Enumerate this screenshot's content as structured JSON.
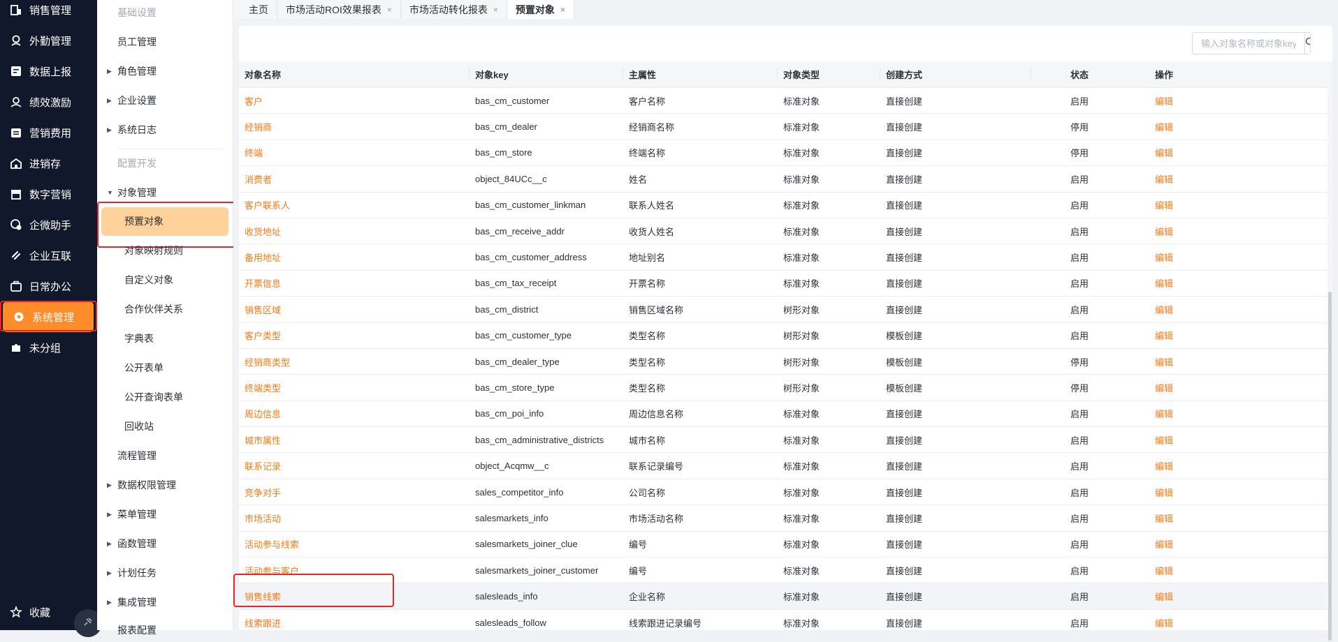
{
  "leftnav": {
    "items": [
      {
        "label": "销售管理",
        "icon": "store-building-icon"
      },
      {
        "label": "外勤管理",
        "icon": "location-person-icon"
      },
      {
        "label": "数据上报",
        "icon": "report-card-icon"
      },
      {
        "label": "绩效激励",
        "icon": "award-person-icon"
      },
      {
        "label": "营销费用",
        "icon": "wallet-icon"
      },
      {
        "label": "进销存",
        "icon": "warehouse-icon"
      },
      {
        "label": "数字营销",
        "icon": "shop-icon"
      },
      {
        "label": "企微助手",
        "icon": "wechat-icon"
      },
      {
        "label": "企业互联",
        "icon": "link-icon"
      },
      {
        "label": "日常办公",
        "icon": "briefcase-icon"
      },
      {
        "label": "系统管理",
        "icon": "gear-icon"
      },
      {
        "label": "未分组",
        "icon": "puzzle-icon"
      }
    ],
    "favorite_label": "收藏"
  },
  "submenu": {
    "items": [
      {
        "label": "基础设置",
        "type": "group"
      },
      {
        "label": "员工管理",
        "type": "item"
      },
      {
        "label": "角色管理",
        "type": "expandable"
      },
      {
        "label": "企业设置",
        "type": "expandable"
      },
      {
        "label": "系统日志",
        "type": "expandable"
      },
      {
        "label": "配置开发",
        "type": "group"
      },
      {
        "label": "对象管理",
        "type": "expanded"
      },
      {
        "label": "预置对象",
        "type": "child-active"
      },
      {
        "label": "对象映射规则",
        "type": "child"
      },
      {
        "label": "自定义对象",
        "type": "child"
      },
      {
        "label": "合作伙伴关系",
        "type": "child"
      },
      {
        "label": "字典表",
        "type": "child"
      },
      {
        "label": "公开表单",
        "type": "child"
      },
      {
        "label": "公开查询表单",
        "type": "child"
      },
      {
        "label": "回收站",
        "type": "child"
      },
      {
        "label": "流程管理",
        "type": "item"
      },
      {
        "label": "数据权限管理",
        "type": "expandable"
      },
      {
        "label": "菜单管理",
        "type": "expandable"
      },
      {
        "label": "函数管理",
        "type": "expandable"
      },
      {
        "label": "计划任务",
        "type": "expandable"
      },
      {
        "label": "集成管理",
        "type": "expandable"
      },
      {
        "label": "报表配置",
        "type": "item"
      }
    ]
  },
  "tabs": [
    {
      "label": "主页",
      "closable": false
    },
    {
      "label": "市场活动ROI效果报表",
      "closable": true
    },
    {
      "label": "市场活动转化报表",
      "closable": true
    },
    {
      "label": "预置对象",
      "closable": true,
      "active": true
    }
  ],
  "search": {
    "placeholder": "输入对象名称或对象key"
  },
  "table": {
    "headers": [
      "对象名称",
      "对象key",
      "主属性",
      "对象类型",
      "创建方式",
      "状态",
      "操作"
    ],
    "rows": [
      [
        "客户",
        "bas_cm_customer",
        "客户名称",
        "标准对象",
        "直接创建",
        "启用",
        "编辑"
      ],
      [
        "经销商",
        "bas_cm_dealer",
        "经销商名称",
        "标准对象",
        "直接创建",
        "停用",
        "编辑"
      ],
      [
        "终端",
        "bas_cm_store",
        "终端名称",
        "标准对象",
        "直接创建",
        "停用",
        "编辑"
      ],
      [
        "消费者",
        "object_84UCc__c",
        "姓名",
        "标准对象",
        "直接创建",
        "启用",
        "编辑"
      ],
      [
        "客户联系人",
        "bas_cm_customer_linkman",
        "联系人姓名",
        "标准对象",
        "直接创建",
        "启用",
        "编辑"
      ],
      [
        "收货地址",
        "bas_cm_receive_addr",
        "收货人姓名",
        "标准对象",
        "直接创建",
        "启用",
        "编辑"
      ],
      [
        "备用地址",
        "bas_cm_customer_address",
        "地址别名",
        "标准对象",
        "直接创建",
        "启用",
        "编辑"
      ],
      [
        "开票信息",
        "bas_cm_tax_receipt",
        "开票名称",
        "标准对象",
        "直接创建",
        "启用",
        "编辑"
      ],
      [
        "销售区域",
        "bas_cm_district",
        "销售区域名称",
        "树形对象",
        "直接创建",
        "启用",
        "编辑"
      ],
      [
        "客户类型",
        "bas_cm_customer_type",
        "类型名称",
        "树形对象",
        "模板创建",
        "启用",
        "编辑"
      ],
      [
        "经销商类型",
        "bas_cm_dealer_type",
        "类型名称",
        "树形对象",
        "模板创建",
        "停用",
        "编辑"
      ],
      [
        "终端类型",
        "bas_cm_store_type",
        "类型名称",
        "树形对象",
        "模板创建",
        "停用",
        "编辑"
      ],
      [
        "周边信息",
        "bas_cm_poi_info",
        "周边信息名称",
        "标准对象",
        "直接创建",
        "启用",
        "编辑"
      ],
      [
        "城市属性",
        "bas_cm_administrative_districts",
        "城市名称",
        "标准对象",
        "直接创建",
        "启用",
        "编辑"
      ],
      [
        "联系记录",
        "object_Acqmw__c",
        "联系记录编号",
        "标准对象",
        "直接创建",
        "启用",
        "编辑"
      ],
      [
        "竞争对手",
        "sales_competitor_info",
        "公司名称",
        "标准对象",
        "直接创建",
        "启用",
        "编辑"
      ],
      [
        "市场活动",
        "salesmarkets_info",
        "市场活动名称",
        "标准对象",
        "直接创建",
        "启用",
        "编辑"
      ],
      [
        "活动参与线索",
        "salesmarkets_joiner_clue",
        "编号",
        "标准对象",
        "直接创建",
        "启用",
        "编辑"
      ],
      [
        "活动参与客户",
        "salesmarkets_joiner_customer",
        "编号",
        "标准对象",
        "直接创建",
        "启用",
        "编辑"
      ],
      [
        "销售线索",
        "salesleads_info",
        "企业名称",
        "标准对象",
        "直接创建",
        "启用",
        "编辑"
      ],
      [
        "线索跟进",
        "salesleads_follow",
        "线索跟进记录编号",
        "标准对象",
        "直接创建",
        "启用",
        "编辑"
      ]
    ]
  },
  "colors": {
    "accent": "#ff8c2a",
    "link": "#ff7a14",
    "nav_bg": "#11182b",
    "highlight_outline": "#e8252b"
  }
}
